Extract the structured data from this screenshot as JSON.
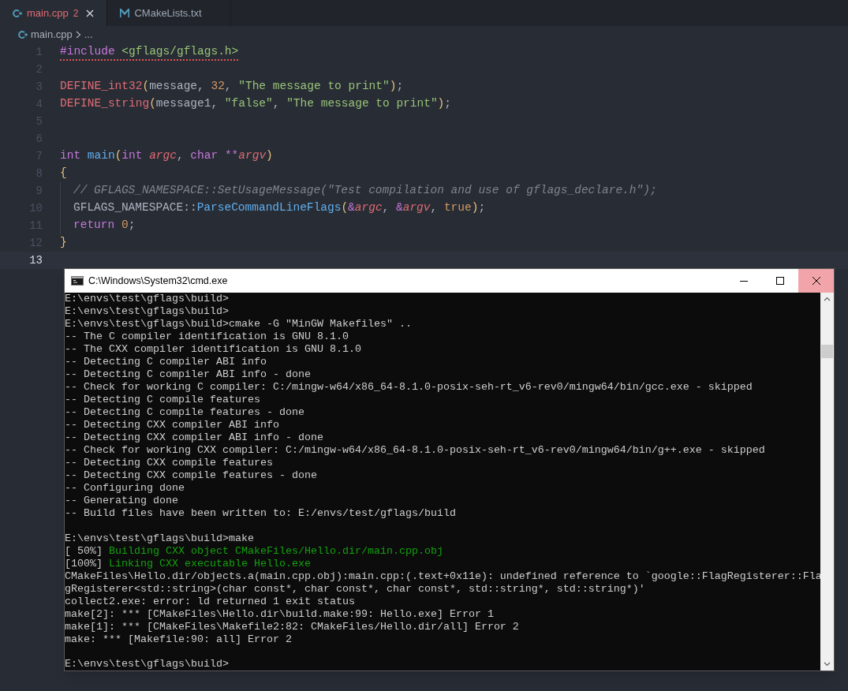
{
  "editor": {
    "tabs": [
      {
        "label": "main.cpp",
        "kind": "cpp",
        "problems": "2",
        "selected": true,
        "error": true
      },
      {
        "label": "CMakeLists.txt",
        "kind": "cmake",
        "selected": false,
        "error": false
      }
    ],
    "breadcrumb": {
      "file": "main.cpp",
      "more": "..."
    },
    "lines": [
      {
        "number": "1",
        "current": false,
        "error": true,
        "indented": false,
        "tokens": [
          {
            "text": "#include",
            "kind": "keyword"
          },
          {
            "text": " <gflags/gflags.h>",
            "kind": "string"
          }
        ]
      },
      {
        "number": "2",
        "current": false
      },
      {
        "number": "3",
        "current": false,
        "error": false,
        "indented": false,
        "tokens": [
          {
            "text": "DEFINE_int32",
            "kind": "macro"
          },
          {
            "text": "(",
            "kind": "bracket"
          },
          {
            "text": "message, ",
            "kind": "plain"
          },
          {
            "text": "32",
            "kind": "number"
          },
          {
            "text": ", ",
            "kind": "plain"
          },
          {
            "text": "\"The message to print\"",
            "kind": "string"
          },
          {
            "text": ")",
            "kind": "bracket"
          },
          {
            "text": ";",
            "kind": "plain"
          }
        ]
      },
      {
        "number": "4",
        "current": false,
        "error": false,
        "indented": false,
        "tokens": [
          {
            "text": "DEFINE_string",
            "kind": "macro"
          },
          {
            "text": "(",
            "kind": "bracket"
          },
          {
            "text": "message1, ",
            "kind": "plain"
          },
          {
            "text": "\"false\"",
            "kind": "string"
          },
          {
            "text": ", ",
            "kind": "plain"
          },
          {
            "text": "\"The message to print\"",
            "kind": "string"
          },
          {
            "text": ")",
            "kind": "bracket"
          },
          {
            "text": ";",
            "kind": "plain"
          }
        ]
      },
      {
        "number": "5",
        "current": false
      },
      {
        "number": "6",
        "current": false
      },
      {
        "number": "7",
        "current": false,
        "error": false,
        "indented": false,
        "tokens": [
          {
            "text": "int ",
            "kind": "keyword"
          },
          {
            "text": "main",
            "kind": "function"
          },
          {
            "text": "(",
            "kind": "bracket"
          },
          {
            "text": "int ",
            "kind": "keyword"
          },
          {
            "text": "argc",
            "kind": "param"
          },
          {
            "text": ", ",
            "kind": "plain"
          },
          {
            "text": "char ",
            "kind": "keyword"
          },
          {
            "text": "**",
            "kind": "operator"
          },
          {
            "text": "argv",
            "kind": "param"
          },
          {
            "text": ")",
            "kind": "bracket"
          }
        ]
      },
      {
        "number": "8",
        "current": false,
        "error": false,
        "indented": false,
        "tokens": [
          {
            "text": "{",
            "kind": "bracket"
          }
        ]
      },
      {
        "number": "9",
        "current": false,
        "error": false,
        "indented": true,
        "tokens": [
          {
            "text": "// GFLAGS_NAMESPACE::SetUsageMessage(\"Test compilation and use of gflags_declare.h\");",
            "kind": "comment"
          }
        ]
      },
      {
        "number": "10",
        "current": false,
        "error": false,
        "indented": true,
        "tokens": [
          {
            "text": "GFLAGS_NAMESPACE::",
            "kind": "plain"
          },
          {
            "text": "ParseCommandLineFlags",
            "kind": "function"
          },
          {
            "text": "(",
            "kind": "bracket"
          },
          {
            "text": "&",
            "kind": "operator"
          },
          {
            "text": "argc",
            "kind": "param"
          },
          {
            "text": ", ",
            "kind": "plain"
          },
          {
            "text": "&",
            "kind": "operator"
          },
          {
            "text": "argv",
            "kind": "param"
          },
          {
            "text": ", ",
            "kind": "plain"
          },
          {
            "text": "true",
            "kind": "number"
          },
          {
            "text": ")",
            "kind": "bracket"
          },
          {
            "text": ";",
            "kind": "plain"
          }
        ]
      },
      {
        "number": "11",
        "current": false,
        "error": false,
        "indented": true,
        "tokens": [
          {
            "text": "return ",
            "kind": "keyword"
          },
          {
            "text": "0",
            "kind": "number"
          },
          {
            "text": ";",
            "kind": "plain"
          }
        ]
      },
      {
        "number": "12",
        "current": false,
        "error": false,
        "indented": false,
        "tokens": [
          {
            "text": "}",
            "kind": "bracket"
          }
        ]
      },
      {
        "number": "13",
        "current": true
      }
    ]
  },
  "console": {
    "title": "C:\\Windows\\System32\\cmd.exe",
    "lines": [
      {
        "kind": "output",
        "text": "E:\\envs\\test\\gflags\\build>"
      },
      {
        "kind": "output",
        "text": "E:\\envs\\test\\gflags\\build>"
      },
      {
        "kind": "output",
        "text": "E:\\envs\\test\\gflags\\build>cmake -G \"MinGW Makefiles\" .."
      },
      {
        "kind": "output",
        "text": "-- The C compiler identification is GNU 8.1.0"
      },
      {
        "kind": "output",
        "text": "-- The CXX compiler identification is GNU 8.1.0"
      },
      {
        "kind": "output",
        "text": "-- Detecting C compiler ABI info"
      },
      {
        "kind": "output",
        "text": "-- Detecting C compiler ABI info - done"
      },
      {
        "kind": "output",
        "text": "-- Check for working C compiler: C:/mingw-w64/x86_64-8.1.0-posix-seh-rt_v6-rev0/mingw64/bin/gcc.exe - skipped"
      },
      {
        "kind": "output",
        "text": "-- Detecting C compile features"
      },
      {
        "kind": "output",
        "text": "-- Detecting C compile features - done"
      },
      {
        "kind": "output",
        "text": "-- Detecting CXX compiler ABI info"
      },
      {
        "kind": "output",
        "text": "-- Detecting CXX compiler ABI info - done"
      },
      {
        "kind": "output",
        "text": "-- Check for working CXX compiler: C:/mingw-w64/x86_64-8.1.0-posix-seh-rt_v6-rev0/mingw64/bin/g++.exe - skipped"
      },
      {
        "kind": "output",
        "text": "-- Detecting CXX compile features"
      },
      {
        "kind": "output",
        "text": "-- Detecting CXX compile features - done"
      },
      {
        "kind": "output",
        "text": "-- Configuring done"
      },
      {
        "kind": "output",
        "text": "-- Generating done"
      },
      {
        "kind": "output",
        "text": "-- Build files have been written to: E:/envs/test/gflags/build"
      },
      {
        "kind": "blank"
      },
      {
        "kind": "output",
        "text": "E:\\envs\\test\\gflags\\build>make"
      },
      {
        "kind": "progress",
        "prefix": "[ 50%] ",
        "text": "Building CXX object CMakeFiles/Hello.dir/main.cpp.obj"
      },
      {
        "kind": "progress",
        "prefix": "[100%] ",
        "text": "Linking CXX executable Hello.exe"
      },
      {
        "kind": "output",
        "text": "CMakeFiles\\Hello.dir/objects.a(main.cpp.obj):main.cpp:(.text+0x11e): undefined reference to `google::FlagRegisterer::Fla"
      },
      {
        "kind": "output",
        "text": "gRegisterer<std::string>(char const*, char const*, char const*, std::string*, std::string*)'"
      },
      {
        "kind": "output",
        "text": "collect2.exe: error: ld returned 1 exit status"
      },
      {
        "kind": "output",
        "text": "make[2]: *** [CMakeFiles\\Hello.dir\\build.make:99: Hello.exe] Error 1"
      },
      {
        "kind": "output",
        "text": "make[1]: *** [CMakeFiles\\Makefile2:82: CMakeFiles/Hello.dir/all] Error 2"
      },
      {
        "kind": "output",
        "text": "make: *** [Makefile:90: all] Error 2"
      },
      {
        "kind": "blank"
      },
      {
        "kind": "output",
        "text": "E:\\envs\\test\\gflags\\build>"
      }
    ]
  }
}
